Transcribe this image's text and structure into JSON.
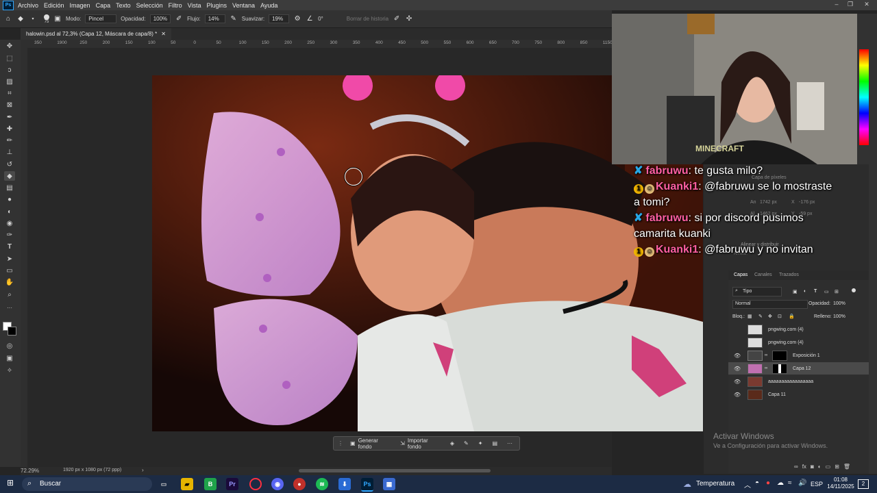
{
  "menu": {
    "items": [
      "Archivo",
      "Edición",
      "Imagen",
      "Capa",
      "Texto",
      "Selección",
      "Filtro",
      "Vista",
      "Plugins",
      "Ventana",
      "Ayuda"
    ]
  },
  "options": {
    "brush_size": "75",
    "mode_label": "Modo:",
    "mode_value": "Pincel",
    "opacity_label": "Opacidad:",
    "opacity_value": "100%",
    "flow_label": "Flujo:",
    "flow_value": "14%",
    "smooth_label": "Suavizar:",
    "smooth_value": "19%",
    "angle_value": "0°",
    "erase_history": "Borrar de historia"
  },
  "document": {
    "tab_title": "halowin.psd al 72,3% (Capa 12, Máscara de capa/8) *",
    "zoom": "72.29%",
    "doc_info": "1920 px x 1080 px (72 ppp)"
  },
  "ruler": {
    "ticks": [
      "350",
      "1900",
      "250",
      "200",
      "150",
      "100",
      "50",
      "0",
      "50",
      "100",
      "150",
      "200",
      "250",
      "300",
      "350",
      "400",
      "450",
      "500",
      "550",
      "600",
      "650",
      "700",
      "750",
      "800",
      "850",
      "1150"
    ]
  },
  "context_bar": {
    "generate": "Generar fondo",
    "import": "Importar fondo"
  },
  "chat": {
    "messages": [
      {
        "user": "fabruwu",
        "text": ": te gusta milo?"
      },
      {
        "user": "Kuanki1",
        "text": ": @fabruwu se lo mostraste a tomi?"
      },
      {
        "user": "fabruwu",
        "text": ": si por discord pusimos camarita kuanki"
      },
      {
        "user": "Kuanki1",
        "text": ": @fabruwu y no invitan"
      }
    ]
  },
  "properties_behind": {
    "capa_de_pixeles": "Capa de píxeles",
    "an": "An",
    "an_value": "1742 px",
    "x": "X",
    "x_value": "-176 px",
    "al": "Al",
    "al_value": "1462 px",
    "y": "Y",
    "y_value": "-59 px",
    "align_section": "Alinear y distribuir",
    "align_sub": "Alinear:"
  },
  "layers_panel": {
    "tabs": [
      "Capas",
      "Canales",
      "Trazados"
    ],
    "filter_label": "Tipo",
    "blend_mode": "Normal",
    "opacity_label": "Opacidad:",
    "opacity_value": "100%",
    "lock_label": "Bloq.:",
    "fill_label": "Relleno:",
    "fill_value": "100%",
    "layers": [
      {
        "name": "pngwing.com (4)",
        "visible": false
      },
      {
        "name": "pngwing.com (4)",
        "visible": false
      },
      {
        "name": "Exposición 1",
        "visible": true
      },
      {
        "name": "Capa 12",
        "visible": true
      },
      {
        "name": "aaaaaaaaaaaaaaaaa",
        "visible": true
      },
      {
        "name": "Capa 11",
        "visible": true
      }
    ]
  },
  "watermark": {
    "title": "Activar Windows",
    "subtitle": "Ve a Configuración para activar Windows."
  },
  "taskbar": {
    "search": "Buscar",
    "weather": "Temperatura",
    "lang": "ESP",
    "time": "01:08",
    "date": "14/11/2025",
    "notifications": "2"
  },
  "webcam": {
    "shirt_text": "MINECRAFT"
  },
  "colors": {
    "accent": "#31a8ff",
    "chat_user": "#ff5fa2",
    "taskbar_bg": "#1c2b44"
  }
}
